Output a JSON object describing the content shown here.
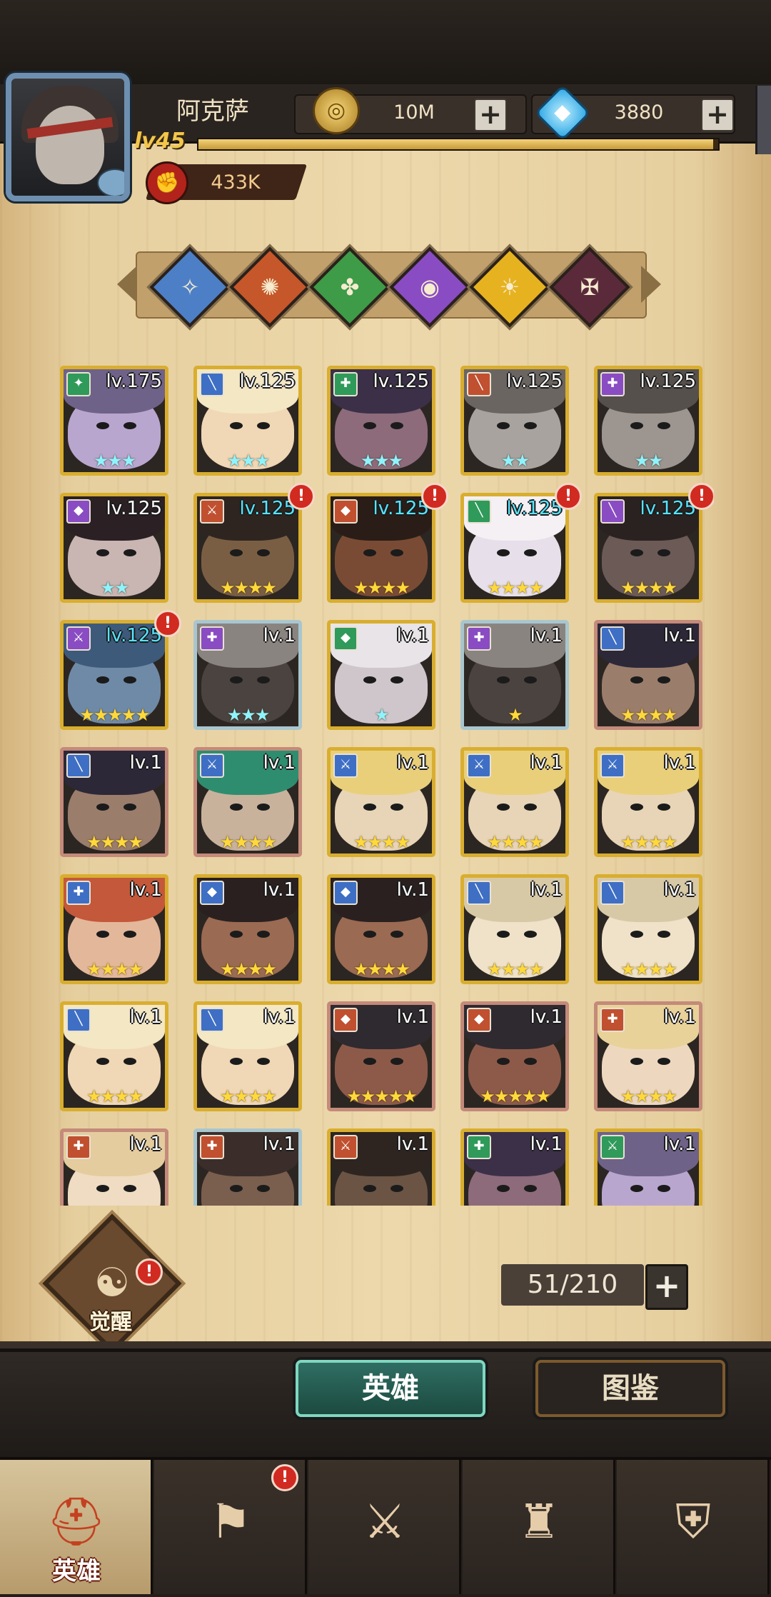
{
  "player": {
    "name": "阿克萨",
    "level_label": "lv45",
    "xp_fraction": 0.99,
    "power": "433K",
    "power_icon": "fist-icon"
  },
  "resources": {
    "gold": {
      "value": "10M",
      "icon": "gold-coin-icon"
    },
    "gems": {
      "value": "3880",
      "icon": "diamond-icon"
    }
  },
  "factions": [
    {
      "name": "faction-light",
      "color": "#4c7fc6",
      "glyph": "✧"
    },
    {
      "name": "faction-fire",
      "color": "#c6572a",
      "glyph": "✺"
    },
    {
      "name": "faction-nature",
      "color": "#3e9b48",
      "glyph": "✤"
    },
    {
      "name": "faction-arcane",
      "color": "#8a4cc2",
      "glyph": "◉"
    },
    {
      "name": "faction-holy",
      "color": "#e6b21f",
      "glyph": "☀"
    },
    {
      "name": "faction-dark",
      "color": "#5a2a3a",
      "glyph": "✠"
    }
  ],
  "heroes": [
    {
      "level": "lv.175",
      "stars": 3,
      "star_color": "teal",
      "frame": "gold",
      "cls": "✦",
      "cls_color": "#2f9a5a",
      "skin": "#b9a6cf",
      "hair": "#6f6288",
      "alert": false,
      "lvl_cyan": false
    },
    {
      "level": "lv.125",
      "stars": 3,
      "star_color": "teal",
      "frame": "gold",
      "cls": "╲",
      "cls_color": "#3e6fc4",
      "skin": "#f0d7b5",
      "hair": "#f3e7c4",
      "alert": false,
      "lvl_cyan": false
    },
    {
      "level": "lv.125",
      "stars": 3,
      "star_color": "teal",
      "frame": "gold",
      "cls": "✚",
      "cls_color": "#2f9a5a",
      "skin": "#8d6b7b",
      "hair": "#3b3048",
      "alert": false,
      "lvl_cyan": false
    },
    {
      "level": "lv.125",
      "stars": 2,
      "star_color": "teal",
      "frame": "gold",
      "cls": "╲",
      "cls_color": "#c0502f",
      "skin": "#a9a3a0",
      "hair": "#6b6562",
      "alert": false,
      "lvl_cyan": false
    },
    {
      "level": "lv.125",
      "stars": 2,
      "star_color": "teal",
      "frame": "gold",
      "cls": "✚",
      "cls_color": "#8a4cc2",
      "skin": "#9c9590",
      "hair": "#56504c",
      "alert": false,
      "lvl_cyan": false
    },
    {
      "level": "lv.125",
      "stars": 2,
      "star_color": "teal",
      "frame": "gold",
      "cls": "◆",
      "cls_color": "#8a4cc2",
      "skin": "#c9b5b2",
      "hair": "#2b2023",
      "alert": false,
      "lvl_cyan": false
    },
    {
      "level": "lv.125",
      "stars": 4,
      "star_color": "gold",
      "frame": "gold",
      "cls": "⚔",
      "cls_color": "#c0502f",
      "skin": "#7a5e44",
      "hair": "#2f2520",
      "alert": true,
      "lvl_cyan": true
    },
    {
      "level": "lv.125",
      "stars": 4,
      "star_color": "gold",
      "frame": "gold",
      "cls": "◆",
      "cls_color": "#c0502f",
      "skin": "#7a4b34",
      "hair": "#2a1d18",
      "alert": true,
      "lvl_cyan": true
    },
    {
      "level": "lv.125",
      "stars": 4,
      "star_color": "gold",
      "frame": "gold",
      "cls": "╲",
      "cls_color": "#2f9a5a",
      "skin": "#e7dfe9",
      "hair": "#f4f0f4",
      "alert": true,
      "lvl_cyan": true
    },
    {
      "level": "lv.125",
      "stars": 4,
      "star_color": "gold",
      "frame": "gold",
      "cls": "╲",
      "cls_color": "#8a4cc2",
      "skin": "#6b5a56",
      "hair": "#2a2221",
      "alert": true,
      "lvl_cyan": true
    },
    {
      "level": "lv.125",
      "stars": 5,
      "star_color": "gold",
      "frame": "gold",
      "cls": "⚔",
      "cls_color": "#8a4cc2",
      "skin": "#6f8aa6",
      "hair": "#3e5a7a",
      "alert": true,
      "lvl_cyan": true
    },
    {
      "level": "lv.1",
      "stars": 3,
      "star_color": "teal",
      "frame": "silver",
      "cls": "✚",
      "cls_color": "#8a4cc2",
      "skin": "#4b4340",
      "hair": "#8a8480",
      "alert": false,
      "lvl_cyan": false
    },
    {
      "level": "lv.1",
      "stars": 1,
      "star_color": "teal",
      "frame": "gold",
      "cls": "◆",
      "cls_color": "#2f9a5a",
      "skin": "#cfc6cc",
      "hair": "#e8e4e8",
      "alert": false,
      "lvl_cyan": false
    },
    {
      "level": "lv.1",
      "stars": 1,
      "star_color": "gold",
      "frame": "silver",
      "cls": "✚",
      "cls_color": "#8a4cc2",
      "skin": "#4b4340",
      "hair": "#8a8480",
      "alert": false,
      "lvl_cyan": false
    },
    {
      "level": "lv.1",
      "stars": 4,
      "star_color": "gold",
      "frame": "bronze",
      "cls": "╲",
      "cls_color": "#3e6fc4",
      "skin": "#9b7d6c",
      "hair": "#2c2838",
      "alert": false,
      "lvl_cyan": false
    },
    {
      "level": "lv.1",
      "stars": 4,
      "star_color": "gold",
      "frame": "bronze",
      "cls": "╲",
      "cls_color": "#3e6fc4",
      "skin": "#9b7d6c",
      "hair": "#2c2838",
      "alert": false,
      "lvl_cyan": false
    },
    {
      "level": "lv.1",
      "stars": 4,
      "star_color": "gold",
      "frame": "bronze",
      "cls": "⚔",
      "cls_color": "#3e6fc4",
      "skin": "#c9b29c",
      "hair": "#2f8d6f",
      "alert": false,
      "lvl_cyan": false
    },
    {
      "level": "lv.1",
      "stars": 4,
      "star_color": "gold",
      "frame": "gold",
      "cls": "⚔",
      "cls_color": "#3e6fc4",
      "skin": "#e8d4b6",
      "hair": "#e9cf7a",
      "alert": false,
      "lvl_cyan": false
    },
    {
      "level": "lv.1",
      "stars": 4,
      "star_color": "gold",
      "frame": "gold",
      "cls": "⚔",
      "cls_color": "#3e6fc4",
      "skin": "#e8d4b6",
      "hair": "#e9cf7a",
      "alert": false,
      "lvl_cyan": false
    },
    {
      "level": "lv.1",
      "stars": 4,
      "star_color": "gold",
      "frame": "gold",
      "cls": "⚔",
      "cls_color": "#3e6fc4",
      "skin": "#e8d4b6",
      "hair": "#e9cf7a",
      "alert": false,
      "lvl_cyan": false
    },
    {
      "level": "lv.1",
      "stars": 4,
      "star_color": "gold",
      "frame": "gold",
      "cls": "✚",
      "cls_color": "#3e6fc4",
      "skin": "#e3b79a",
      "hair": "#c4583a",
      "alert": false,
      "lvl_cyan": false
    },
    {
      "level": "lv.1",
      "stars": 4,
      "star_color": "gold",
      "frame": "gold",
      "cls": "◆",
      "cls_color": "#3e6fc4",
      "skin": "#9a6a52",
      "hair": "#2a2020",
      "alert": false,
      "lvl_cyan": false
    },
    {
      "level": "lv.1",
      "stars": 4,
      "star_color": "gold",
      "frame": "gold",
      "cls": "◆",
      "cls_color": "#3e6fc4",
      "skin": "#9a6a52",
      "hair": "#2a2020",
      "alert": false,
      "lvl_cyan": false
    },
    {
      "level": "lv.1",
      "stars": 4,
      "star_color": "gold",
      "frame": "gold",
      "cls": "╲",
      "cls_color": "#3e6fc4",
      "skin": "#efe2c8",
      "hair": "#d8c9a6",
      "alert": false,
      "lvl_cyan": false
    },
    {
      "level": "lv.1",
      "stars": 4,
      "star_color": "gold",
      "frame": "gold",
      "cls": "╲",
      "cls_color": "#3e6fc4",
      "skin": "#efe2c8",
      "hair": "#d8c9a6",
      "alert": false,
      "lvl_cyan": false
    },
    {
      "level": "lv.1",
      "stars": 4,
      "star_color": "gold",
      "frame": "gold",
      "cls": "╲",
      "cls_color": "#3e6fc4",
      "skin": "#f0d7b5",
      "hair": "#f3e7c4",
      "alert": false,
      "lvl_cyan": false
    },
    {
      "level": "lv.1",
      "stars": 4,
      "star_color": "gold",
      "frame": "gold",
      "cls": "╲",
      "cls_color": "#3e6fc4",
      "skin": "#f0d7b5",
      "hair": "#f3e7c4",
      "alert": false,
      "lvl_cyan": false
    },
    {
      "level": "lv.1",
      "stars": 5,
      "star_color": "gold",
      "frame": "bronze",
      "cls": "◆",
      "cls_color": "#c0502f",
      "skin": "#8d5a4a",
      "hair": "#2f2a30",
      "alert": false,
      "lvl_cyan": false
    },
    {
      "level": "lv.1",
      "stars": 5,
      "star_color": "gold",
      "frame": "bronze",
      "cls": "◆",
      "cls_color": "#c0502f",
      "skin": "#8d5a4a",
      "hair": "#2f2a30",
      "alert": false,
      "lvl_cyan": false
    },
    {
      "level": "lv.1",
      "stars": 4,
      "star_color": "gold",
      "frame": "bronze",
      "cls": "✚",
      "cls_color": "#c0502f",
      "skin": "#edd8bf",
      "hair": "#e8d29a",
      "alert": false,
      "lvl_cyan": false
    },
    {
      "level": "lv.1",
      "stars": 0,
      "star_color": "gold",
      "frame": "bronze",
      "cls": "✚",
      "cls_color": "#c0502f",
      "skin": "#efdcc2",
      "hair": "#e4cc9e",
      "alert": false,
      "lvl_cyan": false
    },
    {
      "level": "lv.1",
      "stars": 0,
      "star_color": "gold",
      "frame": "silver",
      "cls": "✚",
      "cls_color": "#c0502f",
      "skin": "#7a5e4e",
      "hair": "#3b2e2a",
      "alert": false,
      "lvl_cyan": false
    },
    {
      "level": "lv.1",
      "stars": 0,
      "star_color": "gold",
      "frame": "gold",
      "cls": "⚔",
      "cls_color": "#c0502f",
      "skin": "#6b5444",
      "hair": "#2f2520",
      "alert": false,
      "lvl_cyan": false
    },
    {
      "level": "lv.1",
      "stars": 0,
      "star_color": "gold",
      "frame": "gold",
      "cls": "✚",
      "cls_color": "#2f9a5a",
      "skin": "#8d6b7b",
      "hair": "#3b3048",
      "alert": false,
      "lvl_cyan": false
    },
    {
      "level": "lv.1",
      "stars": 0,
      "star_color": "gold",
      "frame": "gold",
      "cls": "⚔",
      "cls_color": "#2f9a5a",
      "skin": "#b9a6cf",
      "hair": "#6f6288",
      "alert": false,
      "lvl_cyan": false
    }
  ],
  "awaken": {
    "label": "觉醒",
    "alert": "!"
  },
  "roster": {
    "count": "51/210",
    "plus": "+"
  },
  "toggles": {
    "heroes": "英雄",
    "codex": "图鉴"
  },
  "nav": [
    {
      "name": "nav-heroes",
      "icon": "helmet-icon",
      "glyph": "⛑",
      "label": "英雄",
      "active": true,
      "alert": false
    },
    {
      "name": "nav-expedition",
      "icon": "flag-compass-icon",
      "glyph": "⚑",
      "label": "",
      "active": false,
      "alert": true
    },
    {
      "name": "nav-battle",
      "icon": "crossed-swords-icon",
      "glyph": "⚔",
      "label": "",
      "active": false,
      "alert": false
    },
    {
      "name": "nav-castle",
      "icon": "castle-icon",
      "glyph": "♜",
      "label": "",
      "active": false,
      "alert": false
    },
    {
      "name": "nav-guild",
      "icon": "handshake-shield-icon",
      "glyph": "⛨",
      "label": "",
      "active": false,
      "alert": false
    }
  ],
  "plus_symbol": "+",
  "alert_symbol": "!"
}
